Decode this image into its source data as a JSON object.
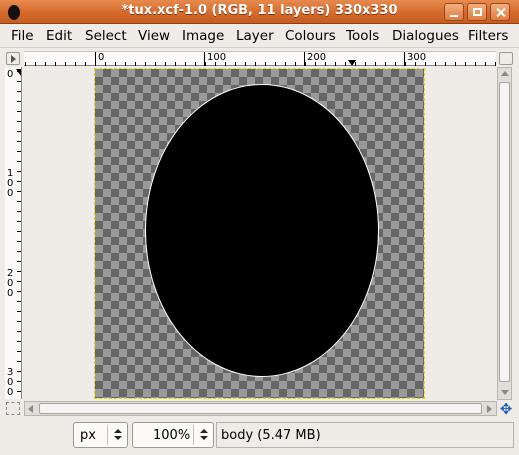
{
  "window": {
    "title": "*tux.xcf-1.0 (RGB, 11 layers) 330x330",
    "colors": {
      "titlebar": "#d56a2c",
      "title_text": "#ffffff",
      "selection": "#e8d800"
    }
  },
  "menubar": {
    "items": [
      "File",
      "Edit",
      "Select",
      "View",
      "Image",
      "Layer",
      "Colours",
      "Tools",
      "Dialogues",
      "Filters"
    ]
  },
  "ruler_top": {
    "ticks": [
      "0",
      "100",
      "200",
      "300"
    ]
  },
  "ruler_left": {
    "ticks": [
      "0",
      "100",
      "200",
      "300"
    ]
  },
  "status": {
    "unit": "px",
    "zoom": "100%",
    "layer_info": "body (5.47 MB)"
  },
  "icons": {
    "app": "gimp-wilber-icon",
    "minimize": "minimize-icon",
    "maximize": "maximize-icon",
    "close": "close-icon",
    "navigate": "navigate-move-icon"
  }
}
